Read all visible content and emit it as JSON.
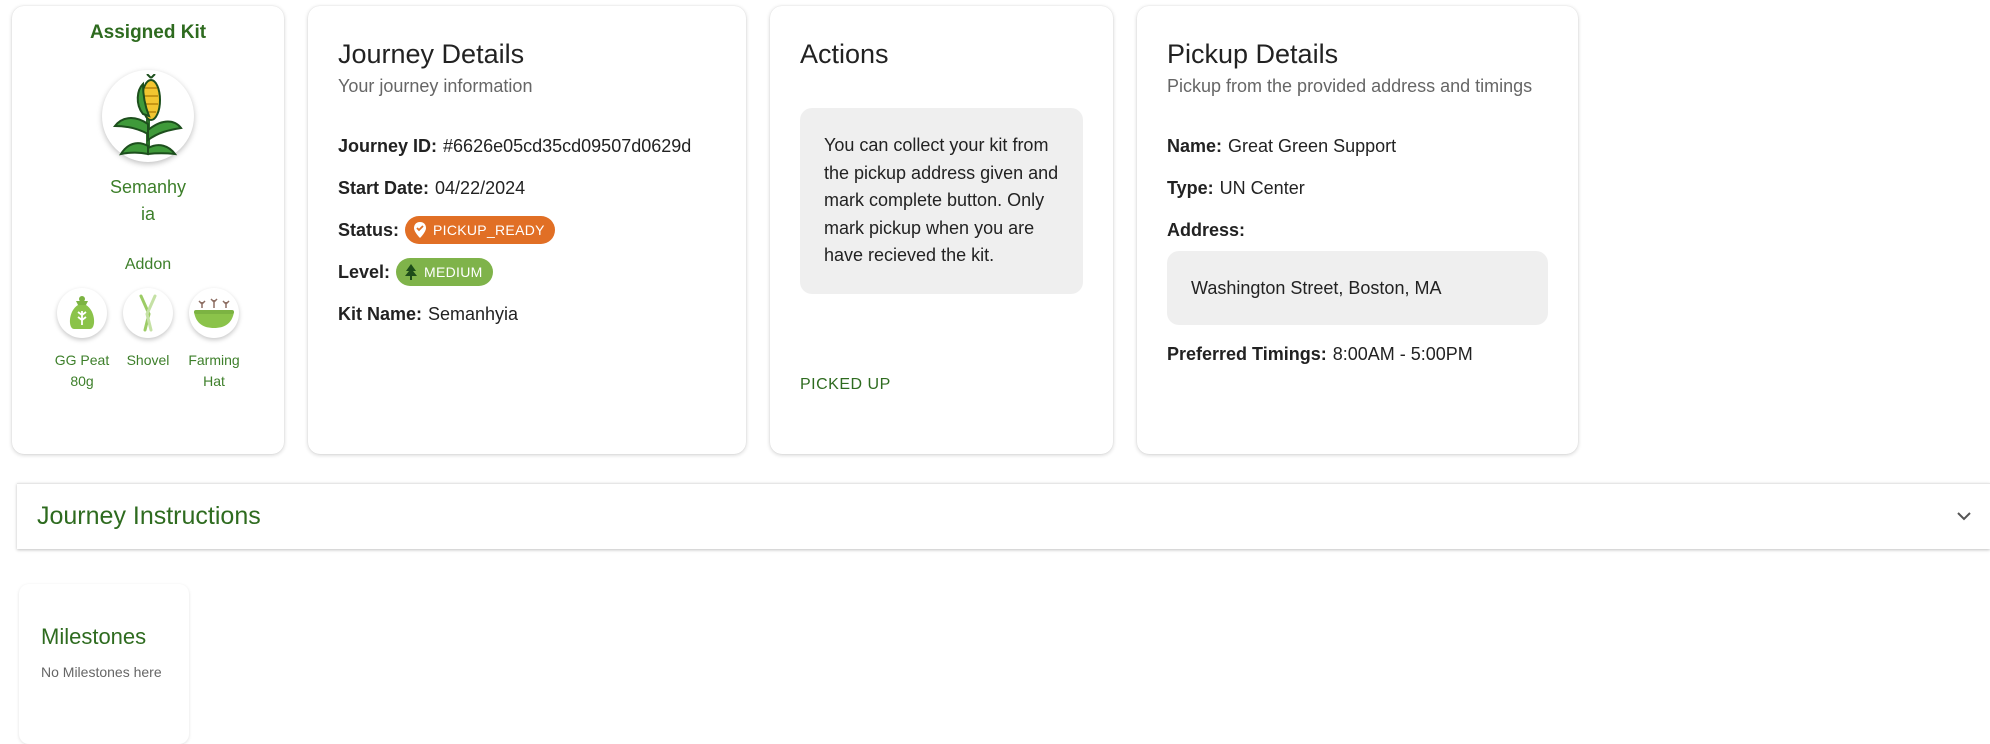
{
  "assigned_kit": {
    "title": "Assigned Kit",
    "kit_name": "Semanhyia",
    "kit_icon": "corn-plant-icon",
    "addon_label": "Addon",
    "addons": [
      {
        "name": "GG Peat 80g",
        "icon": "peat-bag-icon"
      },
      {
        "name": "Shovel",
        "icon": "shovel-icon"
      },
      {
        "name": "Farming Hat",
        "icon": "farming-hat-icon"
      }
    ]
  },
  "journey_details": {
    "title": "Journey Details",
    "subtitle": "Your journey information",
    "journey_id_label": "Journey ID:",
    "journey_id": "#6626e05cd35cd09507d0629d",
    "start_date_label": "Start Date:",
    "start_date": "04/22/2024",
    "status_label": "Status:",
    "status": "PICKUP_READY",
    "status_color": "#e16f25",
    "level_label": "Level:",
    "level": "MEDIUM",
    "level_color": "#7fb34a",
    "kit_name_label": "Kit Name:",
    "kit_name": "Semanhyia"
  },
  "actions": {
    "title": "Actions",
    "note": "You can collect your kit from the pickup address given and mark complete button. Only mark pickup when you are have recieved the kit.",
    "button_label": "PICKED UP"
  },
  "pickup_details": {
    "title": "Pickup Details",
    "subtitle": "Pickup from the provided address and timings",
    "name_label": "Name:",
    "name": "Great Green Support",
    "type_label": "Type:",
    "type": "UN Center",
    "address_label": "Address:",
    "address": "Washington Street, Boston, MA",
    "timings_label": "Preferred Timings:",
    "timings": "8:00AM - 5:00PM"
  },
  "instructions": {
    "title": "Journey Instructions"
  },
  "milestones": {
    "title": "Milestones",
    "empty_text": "No Milestones here"
  },
  "colors": {
    "brand_green": "#2e6b1f",
    "accent_green": "#3d7f2a"
  }
}
